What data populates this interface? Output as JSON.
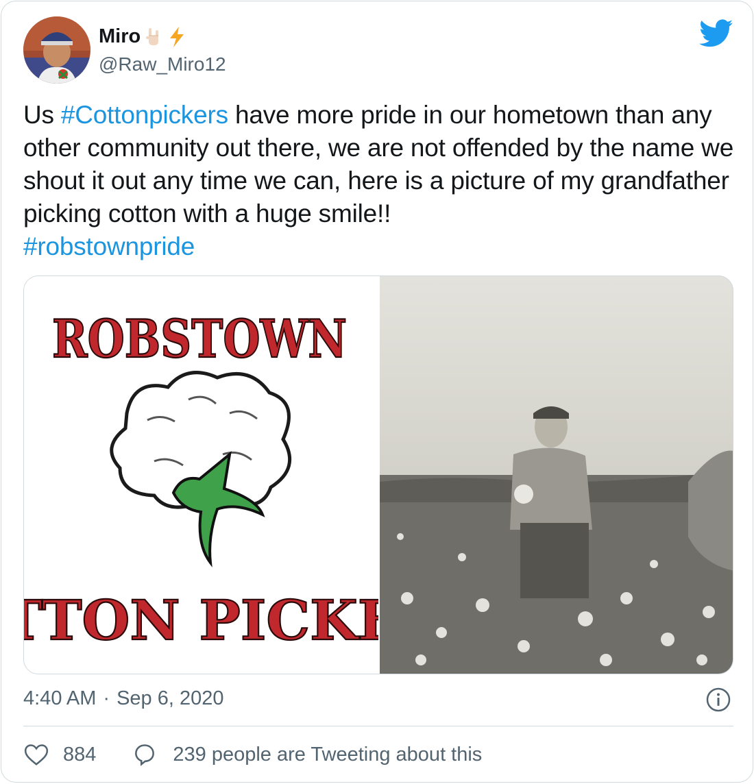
{
  "author": {
    "display_name": "Miro",
    "handle": "@Raw_Miro12",
    "emoji": [
      "sign-of-the-horns-icon",
      "high-voltage-icon"
    ]
  },
  "tweet": {
    "segments": [
      {
        "type": "text",
        "value": "Us "
      },
      {
        "type": "hashtag",
        "value": "#Cottonpickers"
      },
      {
        "type": "text",
        "value": " have more pride in our hometown than any other community out there, we are not offended by the name we shout it out any time we can, here is a picture of my grandfather picking cotton with a huge smile!! "
      },
      {
        "type": "hashtag",
        "value": "#robstownpride"
      }
    ]
  },
  "media": {
    "left": {
      "top_text": "ROBSTOWN",
      "bottom_text": "TTON PICKE",
      "icon": "cotton-boll-icon"
    },
    "right": {
      "description_icon": "vintage-photo-icon"
    }
  },
  "meta": {
    "time": "4:40 AM",
    "separator": "·",
    "date": "Sep 6, 2020"
  },
  "actions": {
    "likes": "884",
    "reply_text": "239 people are Tweeting about this"
  },
  "colors": {
    "link": "#1b95e0",
    "muted": "#536471",
    "text": "#14171a",
    "twitter_blue": "#1d9bf0",
    "logo_red": "#c0282d"
  }
}
